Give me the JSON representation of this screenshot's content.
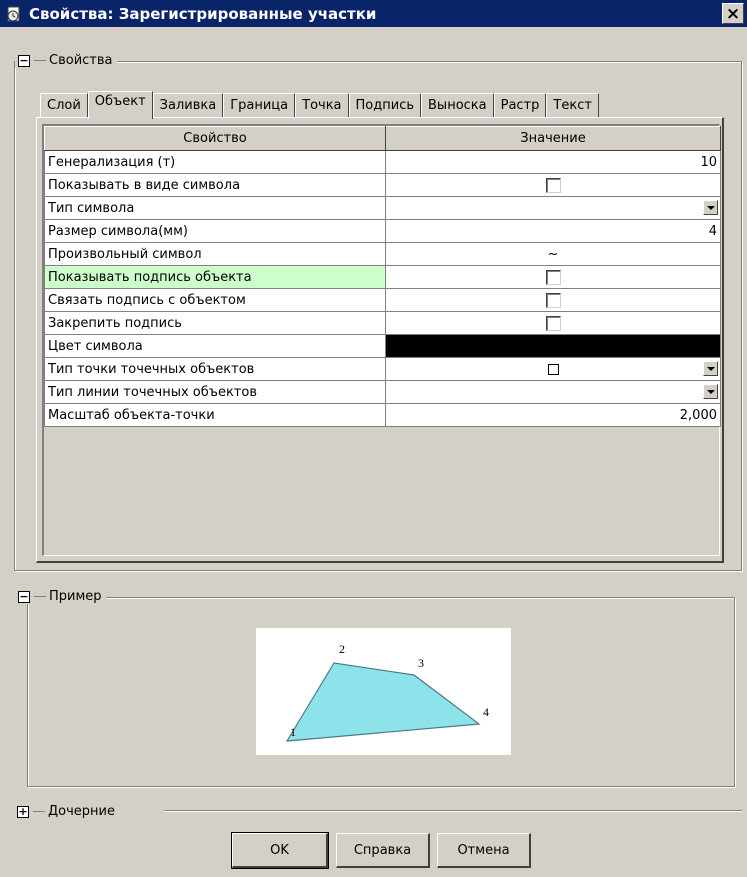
{
  "window": {
    "title": "Свойства: Зарегистрированные участки",
    "close_label": "×"
  },
  "properties_group": {
    "expander": "−",
    "label": "Свойства"
  },
  "tabs": [
    {
      "label": "Слой"
    },
    {
      "label": "Объект",
      "active": true
    },
    {
      "label": "Заливка"
    },
    {
      "label": "Граница"
    },
    {
      "label": "Точка"
    },
    {
      "label": "Подпись"
    },
    {
      "label": "Выноска"
    },
    {
      "label": "Растр"
    },
    {
      "label": "Текст"
    }
  ],
  "grid": {
    "headers": {
      "property": "Свойство",
      "value": "Значение"
    },
    "rows": [
      {
        "name": "Генерализация (т)",
        "value": "10"
      },
      {
        "name": "Показывать в виде символа",
        "value": ""
      },
      {
        "name": "Тип символа",
        "value": ""
      },
      {
        "name": "Размер символа(мм)",
        "value": "4"
      },
      {
        "name": "Произвольный символ",
        "value": "~"
      },
      {
        "name": "Показывать подпись объекта",
        "value": ""
      },
      {
        "name": "Связать подпись с объектом",
        "value": ""
      },
      {
        "name": "Закрепить подпись",
        "value": ""
      },
      {
        "name": "Цвет символа",
        "value": ""
      },
      {
        "name": "Тип точки точечных объектов",
        "value": ""
      },
      {
        "name": "Тип линии точечных объектов",
        "value": ""
      },
      {
        "name": "Масштаб объекта-точки",
        "value": "2,000"
      }
    ],
    "highlight_color": "#ccffcc",
    "symbol_color": "#000000"
  },
  "example_group": {
    "expander": "−",
    "label": "Пример",
    "polygon_fill": "#8ee3ea",
    "vertex_labels": [
      "1",
      "2",
      "3",
      "4"
    ]
  },
  "children_group": {
    "expander": "+",
    "label": "Дочерние"
  },
  "buttons": {
    "ok": "OK",
    "help": "Справка",
    "cancel": "Отмена"
  },
  "colors": {
    "titlebar": "#0a246a",
    "face": "#d4d0c8"
  }
}
